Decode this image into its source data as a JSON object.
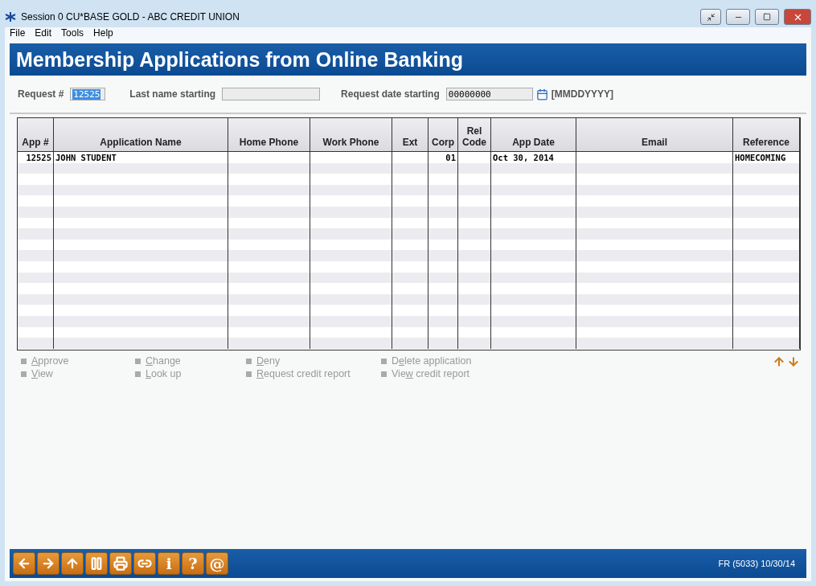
{
  "window": {
    "title": "Session 0 CU*BASE GOLD - ABC CREDIT UNION"
  },
  "menu": [
    "File",
    "Edit",
    "Tools",
    "Help"
  ],
  "header": {
    "title": "Membership Applications from Online Banking"
  },
  "filters": {
    "request_label": "Request #",
    "request_value": "12525",
    "last_name_label": "Last name starting",
    "date_label": "Request date starting",
    "date_value": "00000000",
    "date_format": "[MMDDYYYY]"
  },
  "table": {
    "columns": [
      "App #",
      "Application Name",
      "Home Phone",
      "Work Phone",
      "Ext",
      "Corp",
      "Rel Code",
      "App Date",
      "Email",
      "Reference"
    ],
    "rows": [
      [
        "12525",
        "JOHN STUDENT",
        "",
        "",
        "",
        "01",
        "",
        "Oct 30, 2014",
        "",
        "HOMECOMING"
      ]
    ]
  },
  "actions": [
    {
      "underlined": "A",
      "rest": "pprove"
    },
    {
      "underlined": "V",
      "rest": "iew"
    },
    {
      "underlined": "C",
      "rest": "hange"
    },
    {
      "underlined": "L",
      "rest": "ook up"
    },
    {
      "underlined": "D",
      "rest": "eny"
    },
    {
      "underlined": "R",
      "rest": "equest credit report"
    },
    {
      "lead": "D",
      "underlined": "e",
      "rest": "lete application"
    },
    {
      "lead": "Vie",
      "underlined": "w",
      "rest": " credit report"
    }
  ],
  "footer": {
    "buttons": [
      {
        "kind": "back"
      },
      {
        "kind": "forward"
      },
      {
        "kind": "up"
      },
      {
        "kind": "pause"
      },
      {
        "kind": "print"
      },
      {
        "kind": "link"
      },
      {
        "kind": "text",
        "label": "i"
      },
      {
        "kind": "text",
        "label": "?"
      },
      {
        "kind": "text",
        "label": "@"
      }
    ],
    "status": "FR (5033) 10/30/14"
  }
}
